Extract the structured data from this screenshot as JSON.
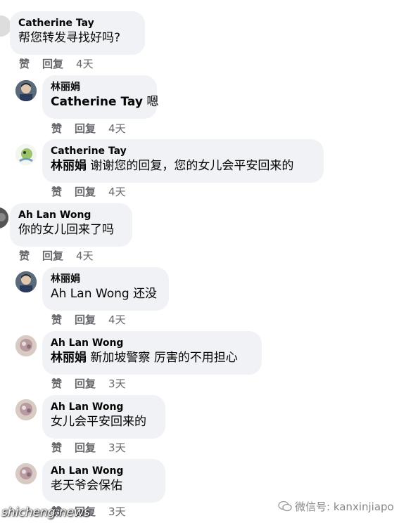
{
  "actions": {
    "like": "赞",
    "reply": "回复"
  },
  "comments": [
    {
      "name": "Catherine Tay",
      "text": "帮您转发寻找好吗?",
      "time": "4天"
    },
    {
      "name": "林丽娟",
      "text": "嗯",
      "mention": "Catherine Tay",
      "time": "4天"
    },
    {
      "name": "Catherine Tay",
      "mention": "林丽娟",
      "text": "谢谢您的回复，您的女儿会平安回来的",
      "time": "4天"
    },
    {
      "name": "Ah Lan Wong",
      "text": "你的女儿回来了吗",
      "time": "4天"
    },
    {
      "name": "林丽娟",
      "mention": "Ah Lan Wong",
      "text": "还没",
      "time": "4天"
    },
    {
      "name": "Ah Lan Wong",
      "mention": "林丽娟",
      "text": "新加坡警察 厉害的不用担心",
      "time": "3天"
    },
    {
      "name": "Ah Lan Wong",
      "text": "女儿会平安回来的",
      "time": "3天"
    },
    {
      "name": "Ah Lan Wong",
      "text": "老天爷会保佑",
      "time": "3天"
    }
  ],
  "watermark": {
    "left": "shicheng.news",
    "right": "微信号: kanxinjiapo"
  }
}
